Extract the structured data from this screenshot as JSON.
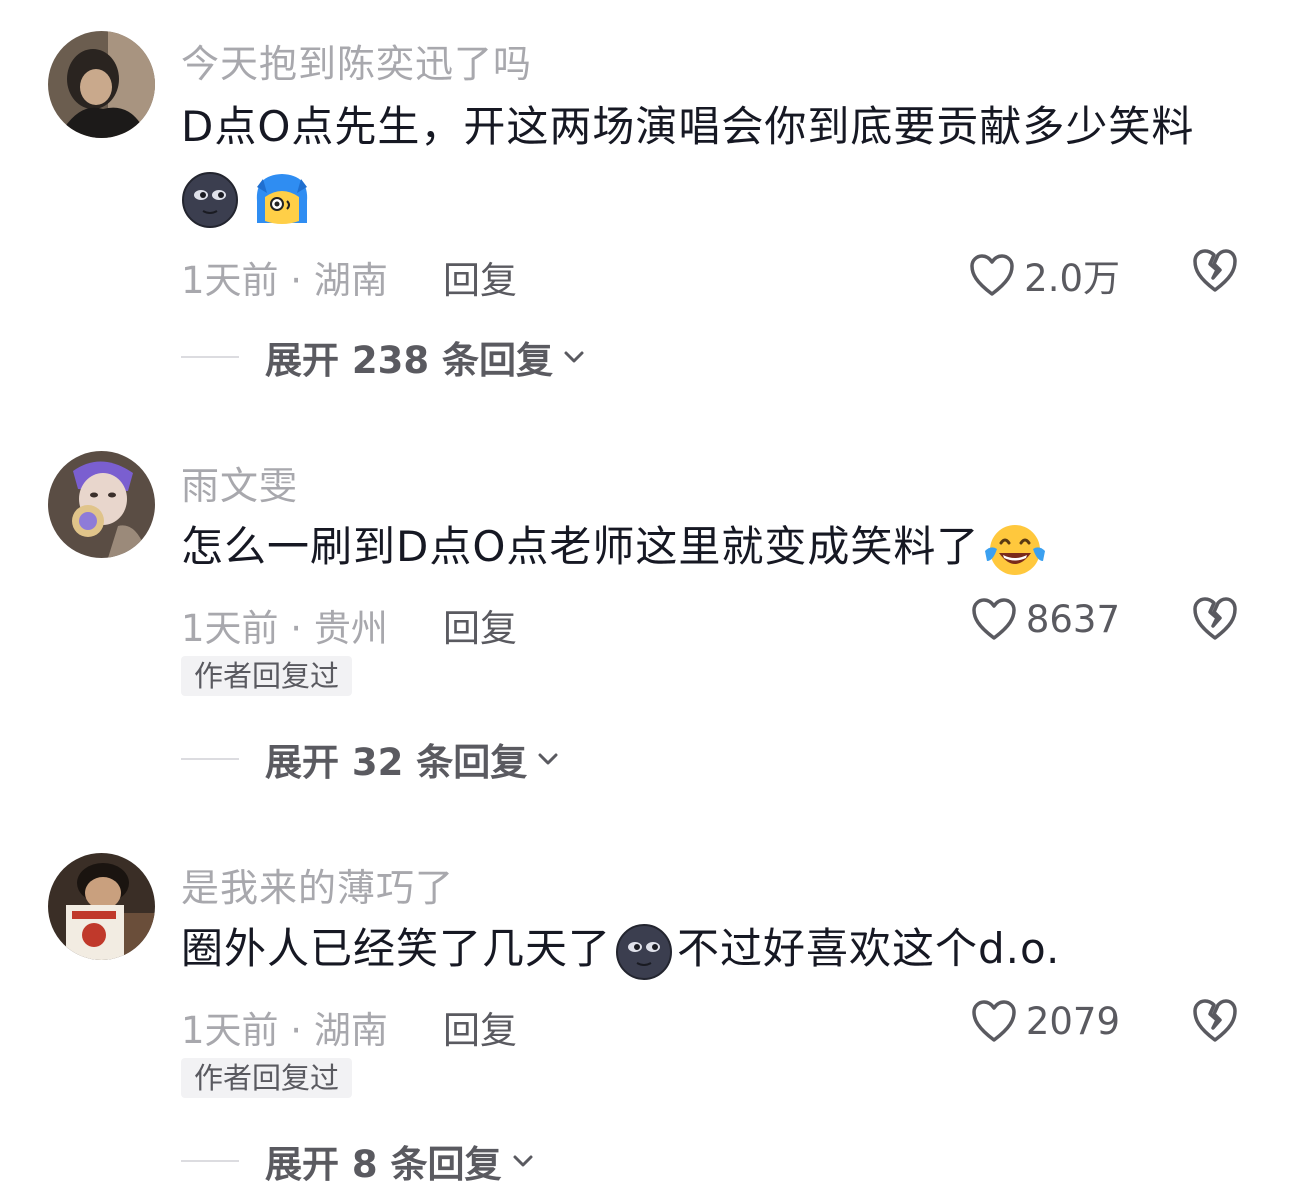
{
  "colors": {
    "username": "#a8a8ad",
    "content": "#161823",
    "meta": "#a8a8ad",
    "action": "#5a5a60",
    "badge_bg": "#f2f2f4"
  },
  "comments": [
    {
      "username": "今天抱到陈奕迅了吗",
      "content": "D点O点先生，开这两场演唱会你到底要贡献多少笑料",
      "emojis": [
        "dark-moon-face-emoji",
        "blue-hair-character-emoji"
      ],
      "time_location": "1天前 · 湖南",
      "reply_label": "回复",
      "likes": "2.0万",
      "expand_label": "展开 238 条回复"
    },
    {
      "username": "雨文雯",
      "content": "怎么一刷到D点O点老师这里就变成笑料了",
      "emojis": [
        "tears-of-joy-emoji"
      ],
      "time_location": "1天前 · 贵州",
      "reply_label": "回复",
      "likes": "8637",
      "badge": "作者回复过",
      "expand_label": "展开 32 条回复"
    },
    {
      "username": "是我来的薄巧了",
      "content_before": "圈外人已经笑了几天了",
      "content_after": "不过好喜欢这个d.o.",
      "emojis": [
        "dark-moon-face-emoji"
      ],
      "time_location": "1天前 · 湖南",
      "reply_label": "回复",
      "likes": "2079",
      "badge": "作者回复过",
      "expand_label": "展开 8 条回复"
    }
  ]
}
